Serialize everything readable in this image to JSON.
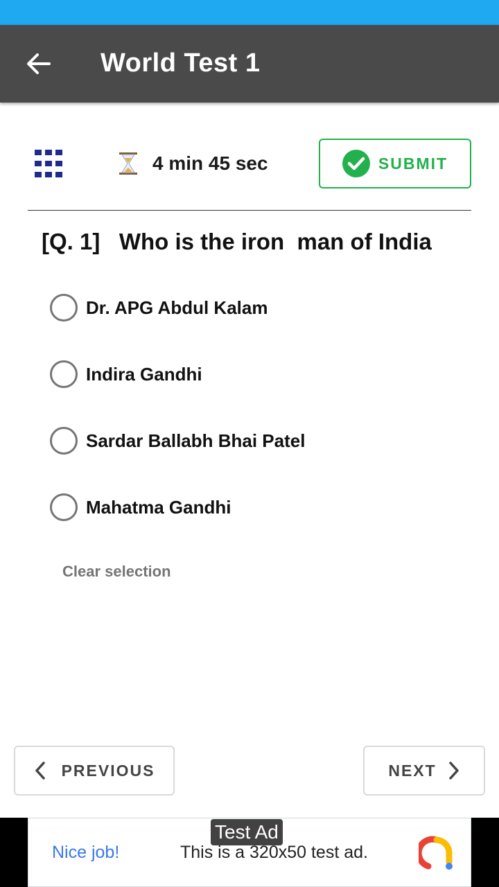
{
  "app_bar": {
    "title": "World Test 1"
  },
  "toolbar": {
    "timer_text": "4 min 45 sec",
    "submit_label": "SUBMIT"
  },
  "question": {
    "number_label": "[Q. 1]",
    "text": "Who is the iron  man of India",
    "options": [
      {
        "label": "Dr. APG Abdul Kalam"
      },
      {
        "label": "Indira Gandhi"
      },
      {
        "label": "Sardar Ballabh Bhai Patel"
      },
      {
        "label": "Mahatma Gandhi"
      }
    ],
    "clear_label": "Clear selection"
  },
  "navigation": {
    "previous_label": "PREVIOUS",
    "next_label": "NEXT"
  },
  "ad": {
    "badge": "Test Ad",
    "headline": "Nice job!",
    "body": "This is a 320x50 test ad."
  },
  "colors": {
    "status_bar": "#1ea9f0",
    "app_bar": "#4a4a4a",
    "accent_green": "#22b14c",
    "grid_icon": "#1f2a8c",
    "ad_link": "#3b78e7"
  },
  "icons": [
    "back-arrow-icon",
    "question-grid-icon",
    "hourglass-icon",
    "check-circle-icon",
    "chevron-left-icon",
    "chevron-right-icon",
    "ad-logo-icon"
  ]
}
